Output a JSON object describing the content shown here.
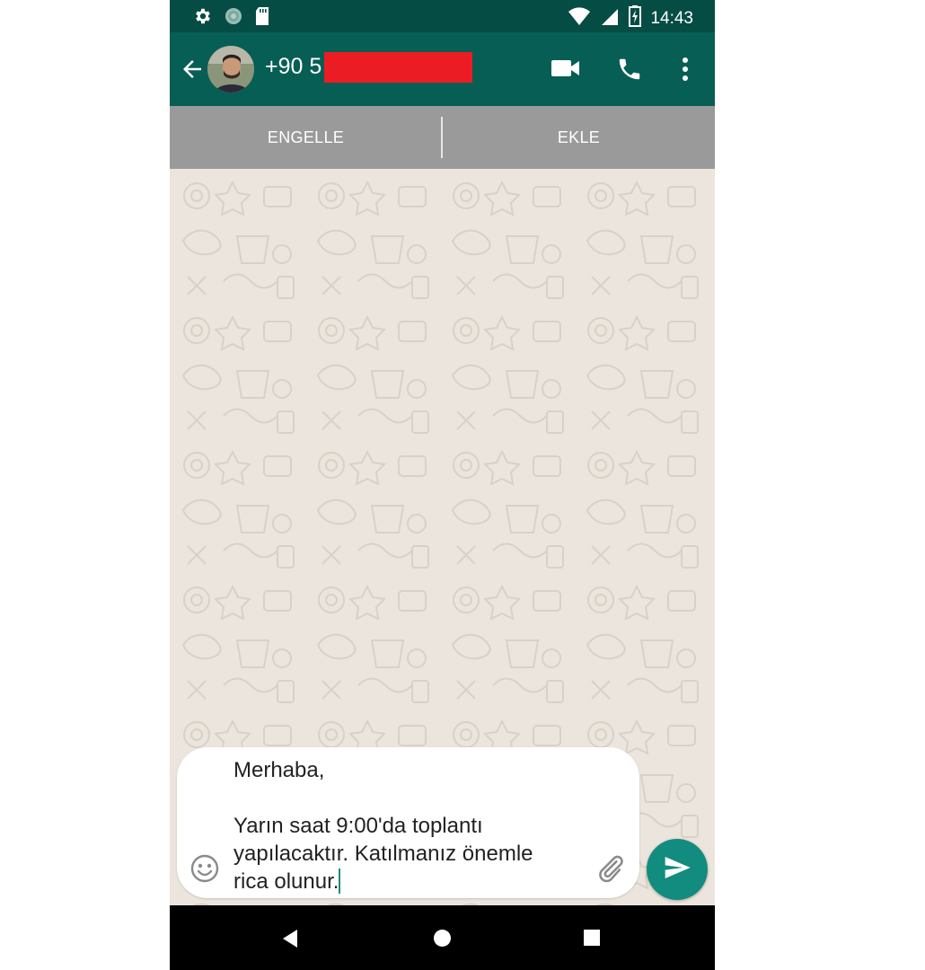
{
  "status_bar": {
    "time": "14:43",
    "icons": [
      "gear-icon",
      "app-notification-icon",
      "sd-card-icon",
      "wifi-icon",
      "signal-icon",
      "battery-icon"
    ]
  },
  "header": {
    "contact_visible_text": "+90 5",
    "icons": [
      "back-arrow-icon",
      "video-call-icon",
      "phone-icon",
      "more-vert-icon"
    ]
  },
  "action_bar": {
    "block_label": "ENGELLE",
    "add_label": "EKLE"
  },
  "composer": {
    "message_text": "Merhaba,\n\nYarın saat 9:00'da toplantı\nyapılacaktır. Katılmanız önemle\nrica olunur.",
    "icons": [
      "emoji-icon",
      "attachment-icon",
      "send-icon"
    ]
  },
  "colors": {
    "header": "#075e54",
    "status_bar": "#054d44",
    "accent": "#128c7e",
    "chat_bg": "#ece5dd",
    "redaction": "#ec1c24"
  }
}
